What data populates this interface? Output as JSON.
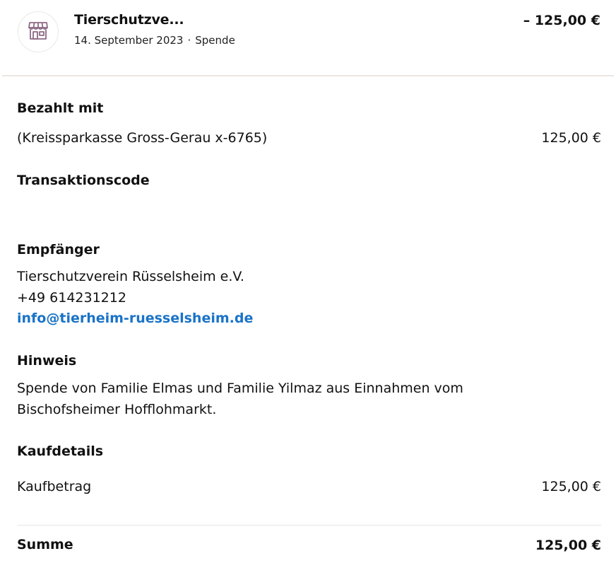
{
  "header": {
    "merchant_name": "Tierschutzve...",
    "date": "14. September 2023",
    "separator": "·",
    "type": "Spende",
    "amount": "– 125,00 €",
    "icon": "store-icon"
  },
  "payment": {
    "title": "Bezahlt mit",
    "source": "(Kreissparkasse Gross-Gerau x-6765)",
    "amount": "125,00 €"
  },
  "transaction": {
    "title": "Transaktionscode"
  },
  "recipient": {
    "title": "Empfänger",
    "name": "Tierschutzverein Rüsselsheim e.V.",
    "phone": "+49 614231212",
    "email": "info@tierheim-ruesselsheim.de"
  },
  "note": {
    "title": "Hinweis",
    "line1": "Spende von Familie Elmas und Familie Yilmaz aus Einnahmen vom",
    "line2": "Bischofsheimer Hofflohmarkt."
  },
  "purchase": {
    "title": "Kaufdetails",
    "label": "Kaufbetrag",
    "amount": "125,00 €"
  },
  "total": {
    "label": "Summe",
    "amount": "125,00 €"
  },
  "colors": {
    "link": "#1a73c8",
    "icon": "#8e6a86",
    "divider": "#e9e7e4"
  }
}
